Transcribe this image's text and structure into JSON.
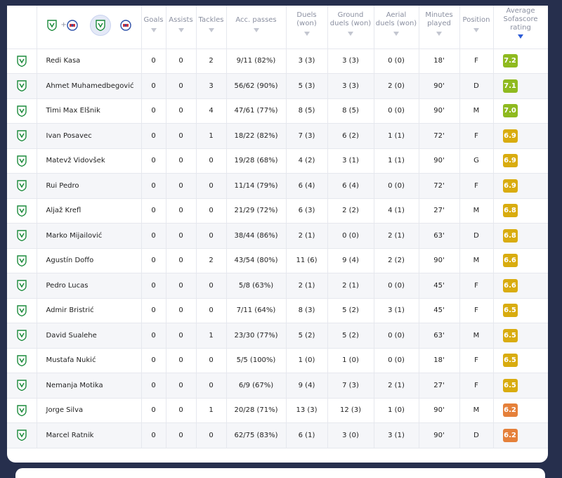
{
  "table": {
    "columns": [
      {
        "key": "goals",
        "label": "Goals"
      },
      {
        "key": "assists",
        "label": "Assists"
      },
      {
        "key": "tackles",
        "label": "Tackles"
      },
      {
        "key": "acc_passes",
        "label": "Acc. passes"
      },
      {
        "key": "duels",
        "label": "Duels (won)"
      },
      {
        "key": "ground_duels",
        "label": "Ground duels (won)"
      },
      {
        "key": "aerial_duels",
        "label": "Aerial duels (won)"
      },
      {
        "key": "minutes",
        "label": "Minutes played"
      },
      {
        "key": "position",
        "label": "Position"
      },
      {
        "key": "rating",
        "label": "Average Sofascore rating"
      }
    ],
    "header_labels": {
      "goals": "Goals",
      "assists": "Assists",
      "tackles": "Tackles",
      "acc_passes": "Acc. passes",
      "duels": "Duels\n(won)",
      "ground_duels": "Ground\nduels (won)",
      "aerial_duels": "Aerial\nduels (won)",
      "minutes": "Minutes\nplayed",
      "position": "Position",
      "rating": "Average\nSofascore\nrating"
    },
    "team_filter": {
      "plus": "+",
      "icons": [
        "olimpija-crest-icon",
        "opponent-crest-icon"
      ]
    },
    "rows": [
      {
        "name": "Redi Kasa",
        "goals": "0",
        "assists": "0",
        "tackles": "2",
        "acc_passes": "9/11 (82%)",
        "duels": "3 (3)",
        "ground_duels": "3 (3)",
        "aerial_duels": "0 (0)",
        "minutes": "18'",
        "position": "F",
        "rating": "7.2",
        "rating_color": "#8fba1f"
      },
      {
        "name": "Ahmet Muhamedbegović",
        "goals": "0",
        "assists": "0",
        "tackles": "3",
        "acc_passes": "56/62 (90%)",
        "duels": "5 (3)",
        "ground_duels": "3 (3)",
        "aerial_duels": "2 (0)",
        "minutes": "90'",
        "position": "D",
        "rating": "7.1",
        "rating_color": "#8fba1f"
      },
      {
        "name": "Timi Max Elšnik",
        "goals": "0",
        "assists": "0",
        "tackles": "4",
        "acc_passes": "47/61 (77%)",
        "duels": "8 (5)",
        "ground_duels": "8 (5)",
        "aerial_duels": "0 (0)",
        "minutes": "90'",
        "position": "M",
        "rating": "7.0",
        "rating_color": "#8fba1f"
      },
      {
        "name": "Ivan Posavec",
        "goals": "0",
        "assists": "0",
        "tackles": "1",
        "acc_passes": "18/22 (82%)",
        "duels": "7 (3)",
        "ground_duels": "6 (2)",
        "aerial_duels": "1 (1)",
        "minutes": "72'",
        "position": "F",
        "rating": "6.9",
        "rating_color": "#d9ac0f"
      },
      {
        "name": "Matevž Vidovšek",
        "goals": "0",
        "assists": "0",
        "tackles": "0",
        "acc_passes": "19/28 (68%)",
        "duels": "4 (2)",
        "ground_duels": "3 (1)",
        "aerial_duels": "1 (1)",
        "minutes": "90'",
        "position": "G",
        "rating": "6.9",
        "rating_color": "#d9ac0f"
      },
      {
        "name": "Rui Pedro",
        "goals": "0",
        "assists": "0",
        "tackles": "0",
        "acc_passes": "11/14 (79%)",
        "duels": "6 (4)",
        "ground_duels": "6 (4)",
        "aerial_duels": "0 (0)",
        "minutes": "72'",
        "position": "F",
        "rating": "6.9",
        "rating_color": "#d9ac0f"
      },
      {
        "name": "Aljaž Krefl",
        "goals": "0",
        "assists": "0",
        "tackles": "0",
        "acc_passes": "21/29 (72%)",
        "duels": "6 (3)",
        "ground_duels": "2 (2)",
        "aerial_duels": "4 (1)",
        "minutes": "27'",
        "position": "M",
        "rating": "6.8",
        "rating_color": "#d9ac0f"
      },
      {
        "name": "Marko Mijailović",
        "goals": "0",
        "assists": "0",
        "tackles": "0",
        "acc_passes": "38/44 (86%)",
        "duels": "2 (1)",
        "ground_duels": "0 (0)",
        "aerial_duels": "2 (1)",
        "minutes": "63'",
        "position": "D",
        "rating": "6.8",
        "rating_color": "#d9ac0f"
      },
      {
        "name": "Agustín Doffo",
        "goals": "0",
        "assists": "0",
        "tackles": "2",
        "acc_passes": "43/54 (80%)",
        "duels": "11 (6)",
        "ground_duels": "9 (4)",
        "aerial_duels": "2 (2)",
        "minutes": "90'",
        "position": "M",
        "rating": "6.6",
        "rating_color": "#d9ac0f"
      },
      {
        "name": "Pedro Lucas",
        "goals": "0",
        "assists": "0",
        "tackles": "0",
        "acc_passes": "5/8 (63%)",
        "duels": "2 (1)",
        "ground_duels": "2 (1)",
        "aerial_duels": "0 (0)",
        "minutes": "45'",
        "position": "F",
        "rating": "6.6",
        "rating_color": "#d9ac0f"
      },
      {
        "name": "Admir Bristrić",
        "goals": "0",
        "assists": "0",
        "tackles": "0",
        "acc_passes": "7/11 (64%)",
        "duels": "8 (3)",
        "ground_duels": "5 (2)",
        "aerial_duels": "3 (1)",
        "minutes": "45'",
        "position": "F",
        "rating": "6.5",
        "rating_color": "#d9ac0f"
      },
      {
        "name": "David Sualehe",
        "goals": "0",
        "assists": "0",
        "tackles": "1",
        "acc_passes": "23/30 (77%)",
        "duels": "5 (2)",
        "ground_duels": "5 (2)",
        "aerial_duels": "0 (0)",
        "minutes": "63'",
        "position": "M",
        "rating": "6.5",
        "rating_color": "#d9ac0f"
      },
      {
        "name": "Mustafa Nukić",
        "goals": "0",
        "assists": "0",
        "tackles": "0",
        "acc_passes": "5/5 (100%)",
        "duels": "1 (0)",
        "ground_duels": "1 (0)",
        "aerial_duels": "0 (0)",
        "minutes": "18'",
        "position": "F",
        "rating": "6.5",
        "rating_color": "#d9ac0f"
      },
      {
        "name": "Nemanja Motika",
        "goals": "0",
        "assists": "0",
        "tackles": "0",
        "acc_passes": "6/9 (67%)",
        "duels": "9 (4)",
        "ground_duels": "7 (3)",
        "aerial_duels": "2 (1)",
        "minutes": "27'",
        "position": "F",
        "rating": "6.5",
        "rating_color": "#d9ac0f"
      },
      {
        "name": "Jorge Silva",
        "goals": "0",
        "assists": "0",
        "tackles": "1",
        "acc_passes": "20/28 (71%)",
        "duels": "13 (3)",
        "ground_duels": "12 (3)",
        "aerial_duels": "1 (0)",
        "minutes": "90'",
        "position": "M",
        "rating": "6.2",
        "rating_color": "#e5803a"
      },
      {
        "name": "Marcel Ratnik",
        "goals": "0",
        "assists": "0",
        "tackles": "0",
        "acc_passes": "62/75 (83%)",
        "duels": "6 (1)",
        "ground_duels": "3 (0)",
        "aerial_duels": "3 (1)",
        "minutes": "90'",
        "position": "D",
        "rating": "6.2",
        "rating_color": "#e5803a"
      }
    ]
  },
  "colors": {
    "background": "#262f4d",
    "team_green": "#1a8a3a",
    "opponent_blue": "#2b4fa8",
    "sort_active": "#2c5bd6"
  }
}
